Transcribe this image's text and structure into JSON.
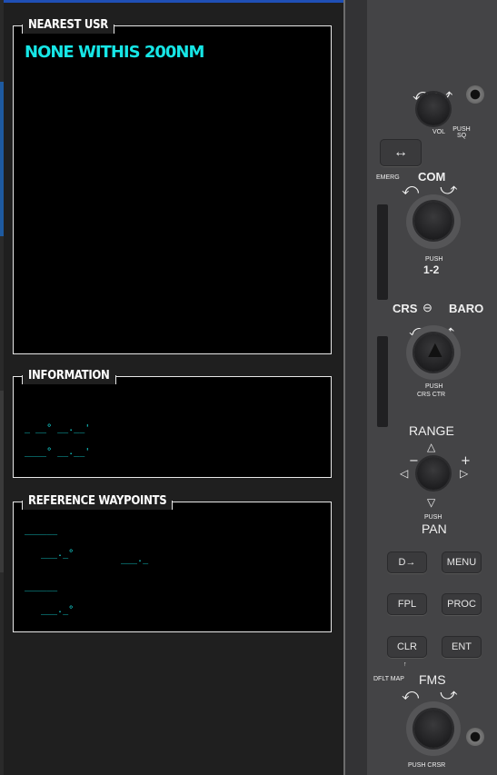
{
  "nearest_usr": {
    "title": "NEAREST USR",
    "message": "NONE WITHIS 200NM"
  },
  "information": {
    "title": "INFORMATION",
    "lat_line": "_ __° __.__'",
    "lon_line": "____° __.__'"
  },
  "reference_waypoints": {
    "title": "REFERENCE WAYPOINTS",
    "wpt1_name": "______",
    "wpt1_brg": "___._°",
    "wpt1_dis": "___._",
    "wpt2_name": "______",
    "wpt2_brg": "___._°"
  },
  "bezel": {
    "vol_label": "VOL",
    "push_sq": "PUSH SQ",
    "emerg": "EMERG",
    "com": "COM",
    "push": "PUSH",
    "one_two": "1-2",
    "crs": "CRS",
    "baro": "BARO",
    "crs_push": "PUSH",
    "crs_ctr": "CRS CTR",
    "range": "RANGE",
    "pan_push": "PUSH",
    "pan": "PAN",
    "direct_to": "D→",
    "menu": "MENU",
    "fpl": "FPL",
    "proc": "PROC",
    "clr": "CLR",
    "ent": "ENT",
    "dflt_map": "DFLT MAP",
    "fms": "FMS",
    "push_crsr": "PUSH CRSR"
  }
}
